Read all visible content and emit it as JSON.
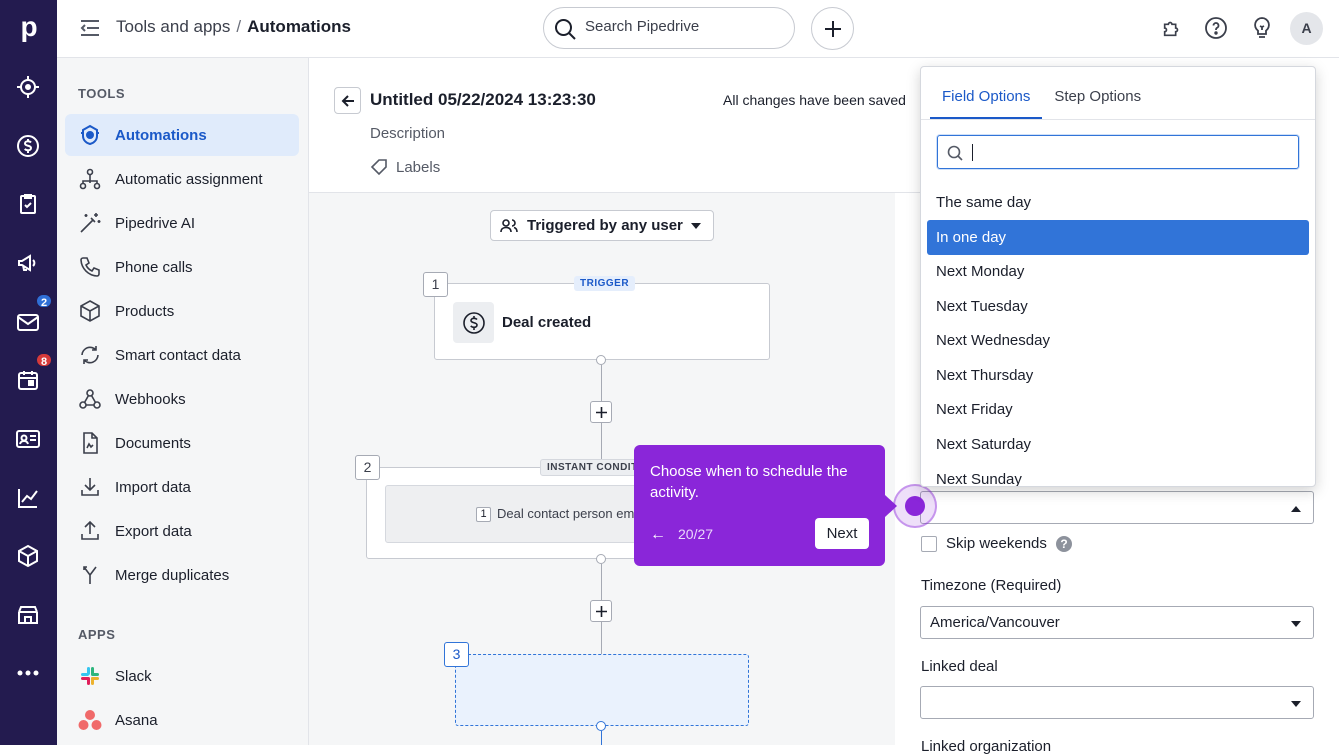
{
  "rail": {
    "logo": "p",
    "badges": {
      "mail": "2",
      "calendar": "8"
    }
  },
  "topbar": {
    "breadcrumb_parent": "Tools and apps",
    "breadcrumb_sep": "/",
    "breadcrumb_current": "Automations",
    "search_placeholder": "Search Pipedrive",
    "avatar": "A"
  },
  "sidebar": {
    "tools_heading": "TOOLS",
    "items": [
      "Automations",
      "Automatic assignment",
      "Pipedrive AI",
      "Phone calls",
      "Products",
      "Smart contact data",
      "Webhooks",
      "Documents",
      "Import data",
      "Export data",
      "Merge duplicates"
    ],
    "apps_heading": "APPS",
    "apps": [
      "Slack",
      "Asana"
    ]
  },
  "header": {
    "title": "Untitled 05/22/2024 13:23:30",
    "saved": "All changes have been saved",
    "description": "Description",
    "labels": "Labels"
  },
  "canvas": {
    "trigger_button": "Triggered by any user",
    "node1": {
      "num": "1",
      "tag": "TRIGGER",
      "title": "Deal created"
    },
    "node2": {
      "num": "2",
      "tag": "INSTANT CONDITIONS",
      "cond_num": "1",
      "cond_text": "Deal contact person email"
    },
    "node3": {
      "num": "3"
    }
  },
  "tooltip": {
    "text": "Choose when to schedule the activity.",
    "prev": "←",
    "step": "20/27",
    "next": "Next"
  },
  "right_panel": {
    "skip_weekends": "Skip weekends",
    "timezone_label": "Timezone (Required)",
    "timezone_value": "America/Vancouver",
    "linked_deal_label": "Linked deal",
    "linked_org_label": "Linked organization"
  },
  "dropdown": {
    "tabs": [
      "Field Options",
      "Step Options"
    ],
    "options": [
      "The same day",
      "In one day",
      "Next Monday",
      "Next Tuesday",
      "Next Wednesday",
      "Next Thursday",
      "Next Friday",
      "Next Saturday",
      "Next Sunday"
    ],
    "selected": "In one day"
  },
  "colors": {
    "rail": "#231b4f",
    "accent": "#3174d8",
    "tooltip": "#8a26d9"
  }
}
